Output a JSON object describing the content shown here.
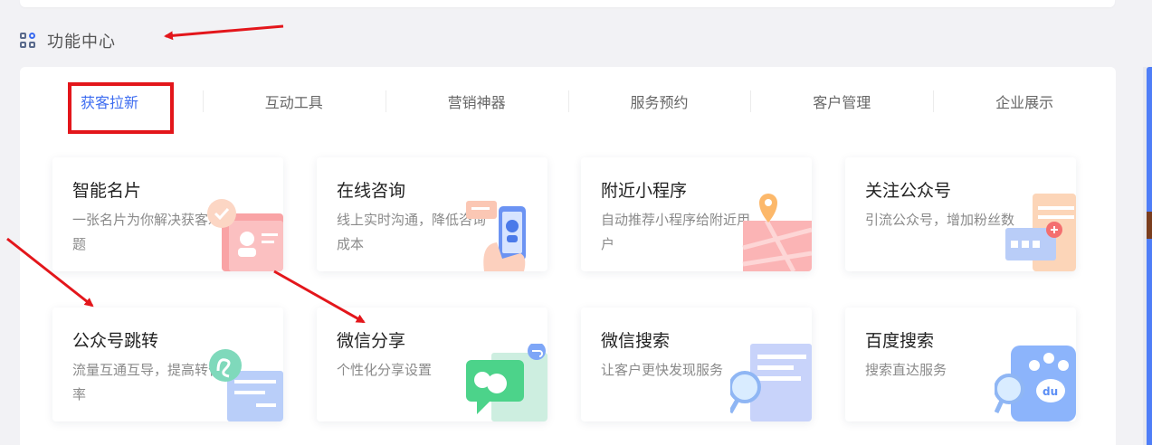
{
  "section": {
    "title": "功能中心",
    "icon": "grid-apps-icon"
  },
  "tabs": [
    {
      "label": "获客拉新",
      "active": true
    },
    {
      "label": "互动工具"
    },
    {
      "label": "营销神器"
    },
    {
      "label": "服务预约"
    },
    {
      "label": "客户管理"
    },
    {
      "label": "企业展示"
    }
  ],
  "cards": [
    {
      "title": "智能名片",
      "desc": "一张名片为你解决获客难题",
      "icon": "business-card-icon"
    },
    {
      "title": "在线咨询",
      "desc": "线上实时沟通，降低咨询成本",
      "icon": "phone-chat-icon"
    },
    {
      "title": "附近小程序",
      "desc": "自动推荐小程序给附近用户",
      "icon": "map-pin-icon"
    },
    {
      "title": "关注公众号",
      "desc": "引流公众号，增加粉丝数",
      "icon": "follow-account-icon"
    },
    {
      "title": "公众号跳转",
      "desc": "流量互通互导，提高转化率",
      "icon": "redirect-icon"
    },
    {
      "title": "微信分享",
      "desc": "个性化分享设置",
      "icon": "wechat-share-icon"
    },
    {
      "title": "微信搜索",
      "desc": "让客户更快发现服务",
      "icon": "search-document-icon"
    },
    {
      "title": "百度搜索",
      "desc": "搜索直达服务",
      "icon": "baidu-search-icon"
    }
  ],
  "colors": {
    "accent": "#3d6cf0",
    "annotation": "#e3161b"
  }
}
